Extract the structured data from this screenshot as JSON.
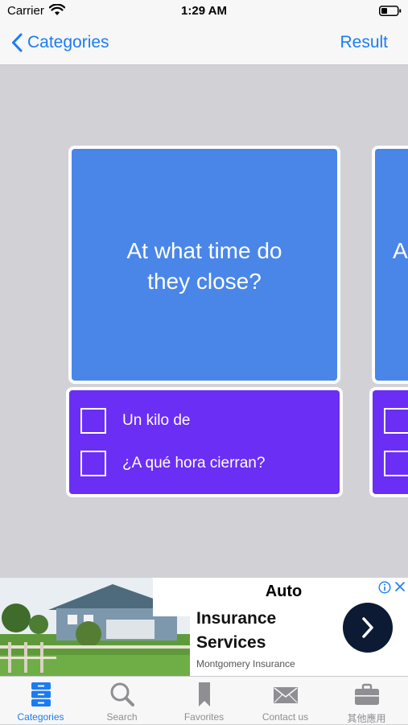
{
  "status_bar": {
    "carrier": "Carrier",
    "time": "1:29 AM"
  },
  "nav": {
    "back_label": "Categories",
    "right_label": "Result"
  },
  "cards": [
    {
      "question_lines": [
        "At what time do",
        "they close?"
      ],
      "answers": [
        "Un kilo de",
        "¿A qué hora cierran?"
      ]
    },
    {
      "question_lines": [
        "A",
        ""
      ],
      "answers": [
        "",
        ""
      ]
    }
  ],
  "ad": {
    "title_top": "Auto",
    "title_lines": [
      "Insurance",
      "Services"
    ],
    "advertiser": "Montgomery Insurance"
  },
  "tabs": [
    {
      "label": "Categories",
      "icon": "drawers-icon",
      "active": true
    },
    {
      "label": "Search",
      "icon": "magnifier-icon",
      "active": false
    },
    {
      "label": "Favorites",
      "icon": "bookmark-icon",
      "active": false
    },
    {
      "label": "Contact us",
      "icon": "envelope-icon",
      "active": false
    },
    {
      "label": "其他應用",
      "icon": "briefcase-icon",
      "active": false
    }
  ],
  "colors": {
    "accent": "#1a7cf5",
    "question_card": "#4a86e8",
    "answer_card": "#6b2ef5",
    "background": "#d1d1d6",
    "inactive_tab": "#8e8e93"
  }
}
